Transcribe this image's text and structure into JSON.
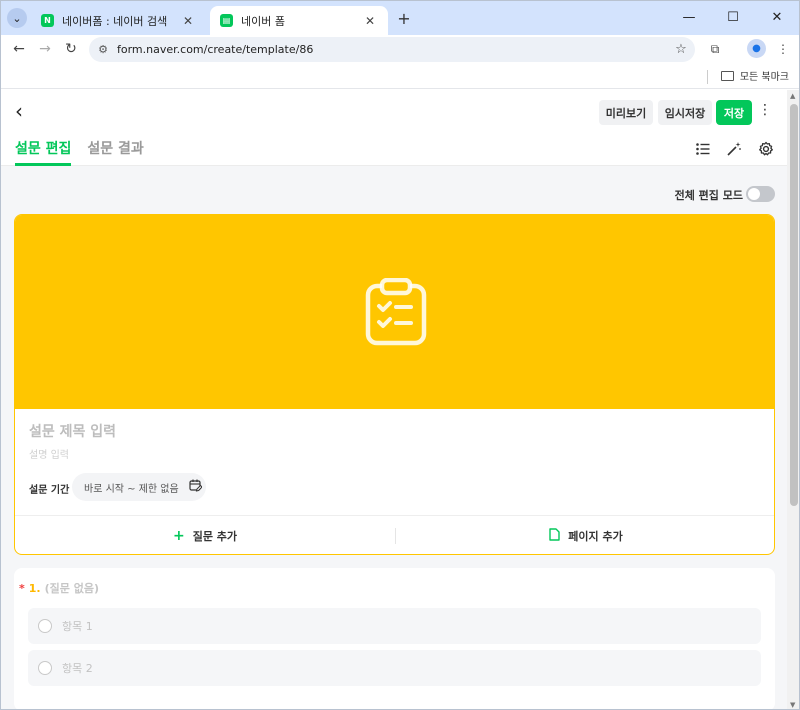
{
  "browser": {
    "tabs": [
      {
        "title": "네이버폼 : 네이버 검색",
        "favicon": "N"
      },
      {
        "title": "네이버 폼",
        "favicon": "form-icon"
      }
    ],
    "url": "form.naver.com/create/template/86",
    "bookmarks_label": "모든 북마크"
  },
  "header": {
    "preview_label": "미리보기",
    "draft_label": "임시저장",
    "save_label": "저장",
    "tabs": [
      {
        "label": "설문 편집",
        "active": true
      },
      {
        "label": "설문 결과",
        "active": false
      }
    ]
  },
  "edit_mode": {
    "label": "전체 편집 모드",
    "on": false
  },
  "form": {
    "banner_color": "#ffc600",
    "title_placeholder": "설문 제목 입력",
    "desc_placeholder": "설명 입력",
    "period_label": "설문 기간",
    "period_value": "바로 시작 ~ 제한 없음",
    "add_question_label": "질문 추가",
    "add_page_label": "페이지 추가"
  },
  "question": {
    "number": "1.",
    "placeholder": "(질문 없음)",
    "options": [
      {
        "label": "항목 1"
      },
      {
        "label": "항목 2"
      }
    ]
  },
  "colors": {
    "accent": "#03c75a",
    "banner": "#ffc600",
    "required": "#f03e3e"
  }
}
